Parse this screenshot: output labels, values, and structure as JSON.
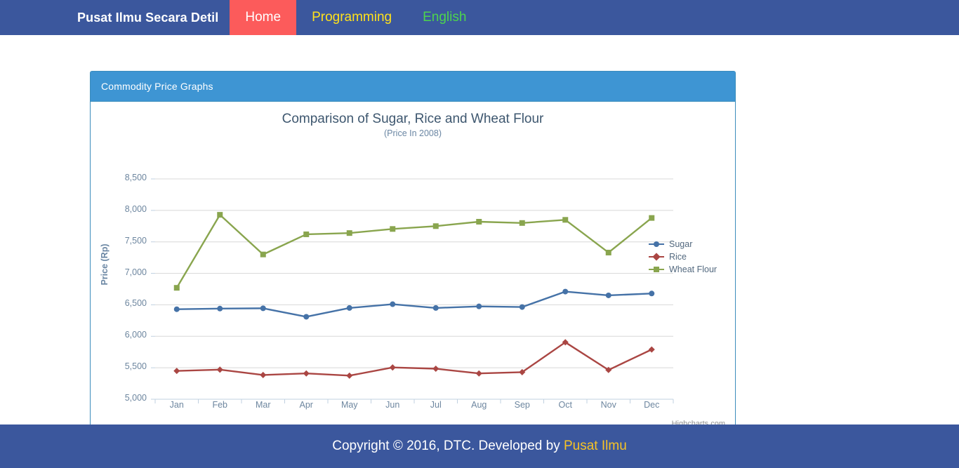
{
  "navbar": {
    "brand": "Pusat Ilmu Secara Detil",
    "items": [
      {
        "label": "Home",
        "state": "active"
      },
      {
        "label": "Programming",
        "state": "programming"
      },
      {
        "label": "English",
        "state": "english"
      }
    ],
    "background_color": "#3b579d",
    "active_color": "#fc5b5b",
    "programming_color": "#ffe11b",
    "english_color": "#4dd44d"
  },
  "panel": {
    "title": "Commodity Price Graphs",
    "header_color": "#3e95d3",
    "border_color": "#3c8dbc"
  },
  "chart_data": {
    "type": "line",
    "title": "Comparison of Sugar, Rice and Wheat Flour",
    "subtitle": "(Price In 2008)",
    "credit": "Highcharts.com",
    "xlabel": "",
    "ylabel": "Price (Rp)",
    "categories": [
      "Jan",
      "Feb",
      "Mar",
      "Apr",
      "May",
      "Jun",
      "Jul",
      "Aug",
      "Sep",
      "Oct",
      "Nov",
      "Dec"
    ],
    "ylim": [
      5000,
      8500
    ],
    "ytick_step": 500,
    "ytick_labels": [
      "5,000",
      "5,500",
      "6,000",
      "6,500",
      "7,000",
      "7,500",
      "8,000",
      "8,500"
    ],
    "grid": true,
    "legend_position": "right",
    "series": [
      {
        "name": "Sugar",
        "color": "#4572a7",
        "marker": "circle",
        "values": [
          6430,
          6440,
          6445,
          6310,
          6450,
          6510,
          6450,
          6475,
          6465,
          6710,
          6650,
          6680
        ]
      },
      {
        "name": "Rice",
        "color": "#aa4643",
        "marker": "diamond",
        "values": [
          5450,
          5470,
          5385,
          5410,
          5375,
          5505,
          5485,
          5410,
          5430,
          5905,
          5465,
          5790
        ]
      },
      {
        "name": "Wheat Flour",
        "color": "#89a54e",
        "marker": "square",
        "values": [
          6770,
          7930,
          7300,
          7620,
          7640,
          7705,
          7750,
          7820,
          7800,
          7850,
          7330,
          7880
        ]
      }
    ]
  },
  "footer": {
    "text_before": "Copyright © 2016, DTC. Developed by ",
    "link": "Pusat Ilmu",
    "link_color": "#f7c325",
    "background_color": "#3b579d"
  }
}
